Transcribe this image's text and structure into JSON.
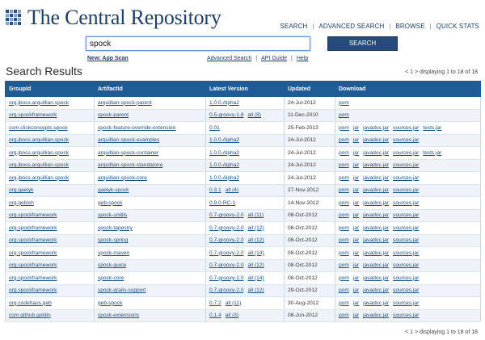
{
  "header": {
    "site_title": "The Central Repository",
    "nav": [
      "SEARCH",
      "ADVANCED SEARCH",
      "BROWSE",
      "QUICK STATS"
    ],
    "nav_separator": "|"
  },
  "search": {
    "query": "spock",
    "button_label": "SEARCH"
  },
  "sublinks": {
    "new_app_scan": "New: App Scan",
    "advanced_search": "Advanced Search",
    "api_guide": "API Guide",
    "help": "Help",
    "separator": "|"
  },
  "results": {
    "title": "Search Results",
    "pager_top": "< 1 > displaying 1 to 18 of 18",
    "pager_bottom": "< 1 > displaying 1 to 18 of 18",
    "columns": [
      "GroupId",
      "ArtifactId",
      "Latest Version",
      "Updated",
      "Download"
    ],
    "rows": [
      {
        "group": "org.jboss.arquillian.spock",
        "artifact": "arquillian-spock-parent",
        "version": "1.0.0.Alpha2",
        "all": "",
        "updated": "24-Jul-2012",
        "downloads": [
          "pom"
        ]
      },
      {
        "group": "org.spockframework",
        "artifact": "spock-parent",
        "version": "0.5-groovy-1.8",
        "all": "all (8)",
        "updated": "11-Dec-2010",
        "downloads": [
          "pom"
        ]
      },
      {
        "group": "com.clickconcepts.spock",
        "artifact": "spock-feature-override-extension",
        "version": "0.01",
        "all": "",
        "updated": "25-Feb-2013",
        "downloads": [
          "pom",
          "jar",
          "javadoc.jar",
          "sources.jar",
          "tests.jar"
        ]
      },
      {
        "group": "org.jboss.arquillian.spock",
        "artifact": "arquillian-spock-examples",
        "version": "1.0.0.Alpha2",
        "all": "",
        "updated": "24-Jul-2012",
        "downloads": [
          "pom",
          "jar",
          "javadoc.jar",
          "sources.jar"
        ]
      },
      {
        "group": "org.jboss.arquillian.spock",
        "artifact": "arquillian-spock-container",
        "version": "1.0.0.Alpha2",
        "all": "",
        "updated": "24-Jul-2012",
        "downloads": [
          "pom",
          "jar",
          "javadoc.jar",
          "sources.jar",
          "tests.jar"
        ]
      },
      {
        "group": "org.jboss.arquillian.spock",
        "artifact": "arquillian-spock-standalone",
        "version": "1.0.0.Alpha2",
        "all": "",
        "updated": "24-Jul-2012",
        "downloads": [
          "pom",
          "jar",
          "javadoc.jar",
          "sources.jar"
        ]
      },
      {
        "group": "org.jboss.arquillian.spock",
        "artifact": "arquillian-spock-core",
        "version": "1.0.0.Alpha2",
        "all": "",
        "updated": "24-Jul-2012",
        "downloads": [
          "pom",
          "jar",
          "javadoc.jar",
          "sources.jar"
        ]
      },
      {
        "group": "org.gaelyk",
        "artifact": "gaelyk-spock",
        "version": "0.3.1",
        "all": "all (4)",
        "updated": "27-Nov-2012",
        "downloads": [
          "pom",
          "jar",
          "javadoc.jar",
          "sources.jar"
        ]
      },
      {
        "group": "org.gebish",
        "artifact": "geb-spock",
        "version": "0.9.0-RC-1",
        "all": "",
        "updated": "14-Nov-2012",
        "downloads": [
          "pom",
          "jar",
          "javadoc.jar",
          "sources.jar"
        ]
      },
      {
        "group": "org.spockframework",
        "artifact": "spock-unitils",
        "version": "0.7-groovy-2.0",
        "all": "all (11)",
        "updated": "08-Oct-2012",
        "downloads": [
          "pom",
          "jar",
          "javadoc.jar",
          "sources.jar"
        ]
      },
      {
        "group": "org.spockframework",
        "artifact": "spock-tapestry",
        "version": "0.7-groovy-2.0",
        "all": "all (12)",
        "updated": "08-Oct-2012",
        "downloads": [
          "pom",
          "jar",
          "javadoc.jar",
          "sources.jar"
        ]
      },
      {
        "group": "org.spockframework",
        "artifact": "spock-spring",
        "version": "0.7-groovy-2.0",
        "all": "all (12)",
        "updated": "08-Oct-2012",
        "downloads": [
          "pom",
          "jar",
          "javadoc.jar",
          "sources.jar"
        ]
      },
      {
        "group": "org.spockframework",
        "artifact": "spock-maven",
        "version": "0.7-groovy-2.0",
        "all": "all (14)",
        "updated": "08-Oct-2012",
        "downloads": [
          "pom",
          "jar",
          "javadoc.jar",
          "sources.jar"
        ]
      },
      {
        "group": "org.spockframework",
        "artifact": "spock-guice",
        "version": "0.7-groovy-2.0",
        "all": "all (12)",
        "updated": "08-Oct-2012",
        "downloads": [
          "pom",
          "jar",
          "javadoc.jar",
          "sources.jar"
        ]
      },
      {
        "group": "org.spockframework",
        "artifact": "spock-core",
        "version": "0.7-groovy-2.0",
        "all": "all (14)",
        "updated": "08-Oct-2012",
        "downloads": [
          "pom",
          "jar",
          "javadoc.jar",
          "sources.jar"
        ]
      },
      {
        "group": "org.spockframework",
        "artifact": "spock-grails-support",
        "version": "0.7-groovy-2.0",
        "all": "all (12)",
        "updated": "29-Oct-2012",
        "downloads": [
          "pom",
          "jar",
          "javadoc.jar",
          "sources.jar"
        ]
      },
      {
        "group": "org.codehaus.geb",
        "artifact": "geb-spock",
        "version": "0.7.2",
        "all": "all (11)",
        "updated": "30-Aug-2012",
        "downloads": [
          "pom",
          "jar",
          "javadoc.jar",
          "sources.jar"
        ]
      },
      {
        "group": "com.github.goldin",
        "artifact": "spock-extensions",
        "version": "0.1.4",
        "all": "all (3)",
        "updated": "08-Jun-2012",
        "downloads": [
          "pom",
          "jar",
          "javadoc.jar",
          "sources.jar"
        ]
      }
    ]
  },
  "colors": {
    "brand": "#1f3f68",
    "table_header": "#1f5c95",
    "link": "#1f4f82",
    "row_alt": "#eef3f9"
  }
}
